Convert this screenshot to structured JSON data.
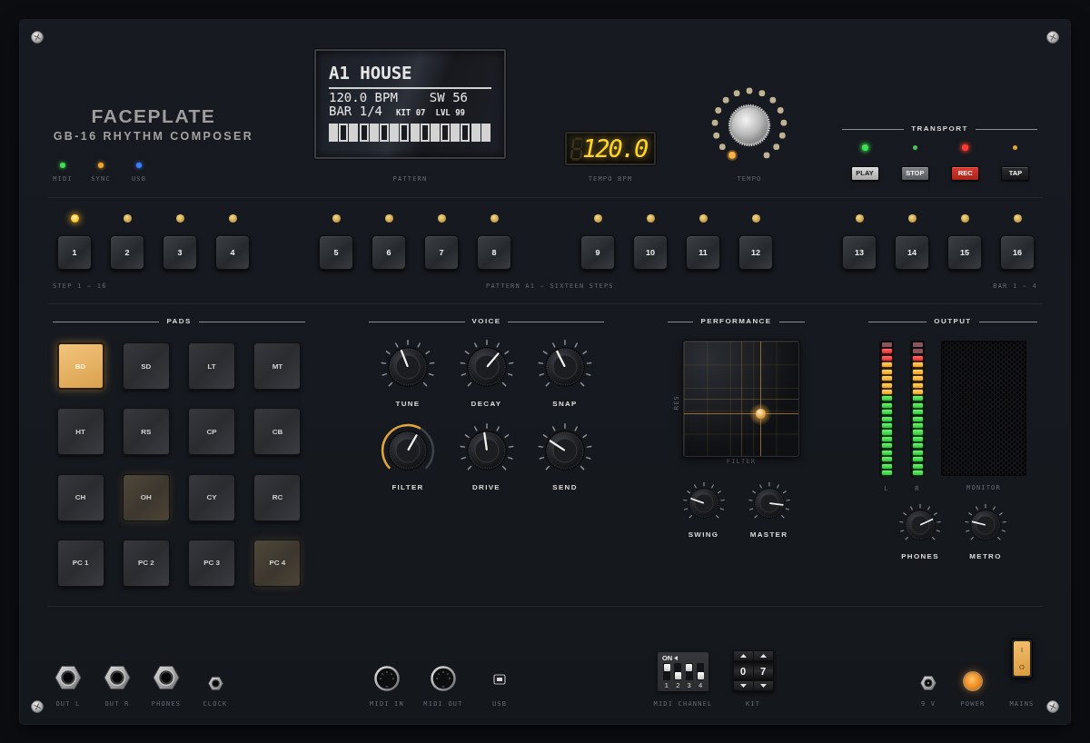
{
  "brand": {
    "name": "FACEPLATE",
    "model": "GB-16 RHYTHM COMPOSER"
  },
  "status_leds": [
    {
      "label": "MIDI",
      "color": "#3ee04f"
    },
    {
      "label": "SYNC",
      "color": "#f2a531"
    },
    {
      "label": "USB",
      "color": "#3d7dff"
    }
  ],
  "lcd": {
    "title": "A1 HOUSE",
    "tempo": "120.0 BPM",
    "swing": "SW 56",
    "bar": "BAR 1/4",
    "kit": "KIT 07",
    "volume": "LVL 99",
    "cells": [
      {
        "filled": true
      },
      {
        "filled": false
      },
      {
        "filled": true
      },
      {
        "filled": false
      },
      {
        "filled": true
      },
      {
        "filled": false
      },
      {
        "filled": true
      },
      {
        "filled": false
      },
      {
        "filled": true
      },
      {
        "filled": false
      },
      {
        "filled": true
      },
      {
        "filled": false
      },
      {
        "filled": true
      },
      {
        "filled": false
      },
      {
        "filled": true
      },
      {
        "filled": true
      }
    ],
    "label": "PATTERN"
  },
  "tempo_display": {
    "value": "120.0",
    "label": "TEMPO BPM"
  },
  "tempo_knob": {
    "label": "TEMPO",
    "ring": [
      {
        "on": true
      },
      {
        "on": false
      },
      {
        "on": false
      },
      {
        "on": false
      },
      {
        "on": false
      },
      {
        "on": false
      },
      {
        "on": false
      },
      {
        "on": false
      },
      {
        "on": false
      },
      {
        "on": false
      },
      {
        "on": false
      },
      {
        "on": false
      },
      {
        "on": false
      },
      {
        "on": false
      },
      {
        "on": false
      }
    ]
  },
  "transport": {
    "title": "TRANSPORT",
    "buttons": [
      {
        "label": "PLAY",
        "kind": "play",
        "color": "#3ee04f",
        "lit": true
      },
      {
        "label": "STOP",
        "kind": "stop",
        "color": "#4cc25a",
        "lit": false
      },
      {
        "label": "REC",
        "kind": "record",
        "color": "#ff3b30",
        "lit": true
      },
      {
        "label": "TAP",
        "kind": "tap",
        "color": "#e0a33a",
        "lit": false
      }
    ]
  },
  "steps": {
    "buttons": [
      {
        "label": "1",
        "selected": true
      },
      {
        "label": "2",
        "selected": false
      },
      {
        "label": "3",
        "selected": false
      },
      {
        "label": "4",
        "selected": false
      },
      {
        "label": "5",
        "selected": false
      },
      {
        "label": "6",
        "selected": false
      },
      {
        "label": "7",
        "selected": false
      },
      {
        "label": "8",
        "selected": false
      },
      {
        "label": "9",
        "selected": false
      },
      {
        "label": "10",
        "selected": false
      },
      {
        "label": "11",
        "selected": false
      },
      {
        "label": "12",
        "selected": false
      },
      {
        "label": "13",
        "selected": false
      },
      {
        "label": "14",
        "selected": false
      },
      {
        "label": "15",
        "selected": false
      },
      {
        "label": "16",
        "selected": false
      }
    ],
    "captions": [
      "STEP 1 — 16",
      "PATTERN A1 — SIXTEEN STEPS",
      "BAR 1 — 4"
    ]
  },
  "pads": {
    "title": "PADS",
    "items": [
      {
        "label": "BD",
        "selected": true,
        "lit": false
      },
      {
        "label": "SD",
        "selected": false,
        "lit": false
      },
      {
        "label": "LT",
        "selected": false,
        "lit": false
      },
      {
        "label": "MT",
        "selected": false,
        "lit": false
      },
      {
        "label": "HT",
        "selected": false,
        "lit": false
      },
      {
        "label": "RS",
        "selected": false,
        "lit": false
      },
      {
        "label": "CP",
        "selected": false,
        "lit": false
      },
      {
        "label": "CB",
        "selected": false,
        "lit": false
      },
      {
        "label": "CH",
        "selected": false,
        "lit": false
      },
      {
        "label": "OH",
        "selected": false,
        "lit": true
      },
      {
        "label": "CY",
        "selected": false,
        "lit": false
      },
      {
        "label": "RC",
        "selected": false,
        "lit": false
      },
      {
        "label": "PC 1",
        "selected": false,
        "lit": false
      },
      {
        "label": "PC 2",
        "selected": false,
        "lit": false
      },
      {
        "label": "PC 3",
        "selected": false,
        "lit": false
      },
      {
        "label": "PC 4",
        "selected": false,
        "lit": true
      }
    ]
  },
  "voice": {
    "title": "VOICE",
    "knobs": [
      {
        "label": "TUNE",
        "level": 0.42,
        "active": false
      },
      {
        "label": "DECAY",
        "level": 0.65,
        "active": false
      },
      {
        "label": "SNAP",
        "level": 0.4,
        "active": false
      },
      {
        "label": "FILTER",
        "level": 0.61,
        "active": true
      },
      {
        "label": "DRIVE",
        "level": 0.47,
        "active": false
      },
      {
        "label": "SEND",
        "level": 0.29,
        "active": false
      }
    ]
  },
  "performance": {
    "title": "PERFORMANCE",
    "xy_pad": {
      "axes": [
        {
          "label": "FILTER",
          "level": 0.67
        },
        {
          "label": "RES",
          "level": 0.37
        }
      ]
    },
    "knobs": [
      {
        "label": "SWING",
        "level": 0.24
      },
      {
        "label": "MASTER",
        "level": 0.86
      }
    ]
  },
  "output": {
    "title": "OUTPUT",
    "meters": [
      {
        "label": "L",
        "level": 0.95
      },
      {
        "label": "R",
        "level": 0.9
      }
    ],
    "monitor": {
      "label": "MONITOR"
    },
    "knobs": [
      {
        "label": "PHONES",
        "level": 0.74
      },
      {
        "label": "METRO",
        "level": 0.22
      }
    ]
  },
  "connector_groups": [
    {
      "items": [
        {
          "kind": "jack",
          "label": "OUT L"
        },
        {
          "kind": "jack",
          "label": "OUT R"
        },
        {
          "kind": "jack",
          "label": "PHONES"
        },
        {
          "kind": "minijack",
          "label": "CLOCK"
        }
      ]
    },
    {
      "items": [
        {
          "kind": "din",
          "label": "MIDI IN"
        },
        {
          "kind": "din",
          "label": "MIDI OUT"
        },
        {
          "kind": "usb",
          "label": "USB"
        }
      ]
    },
    {
      "items": [
        {
          "kind": "dip",
          "label": "MIDI CHANNEL",
          "on_label": "ON",
          "switches": [
            {
              "number": "1",
              "on": true
            },
            {
              "number": "2",
              "on": false
            },
            {
              "number": "3",
              "on": true
            },
            {
              "number": "4",
              "on": false
            }
          ]
        },
        {
          "kind": "thumbwheel",
          "label": "KIT",
          "digits": [
            "0",
            "7"
          ]
        }
      ]
    },
    {
      "items": [
        {
          "kind": "dcjack",
          "label": "9 V"
        },
        {
          "kind": "lamp",
          "label": "POWER",
          "lit": true
        },
        {
          "kind": "rocker",
          "label": "MAINS",
          "on": true,
          "marks": [
            "I",
            "O"
          ]
        }
      ]
    }
  ]
}
